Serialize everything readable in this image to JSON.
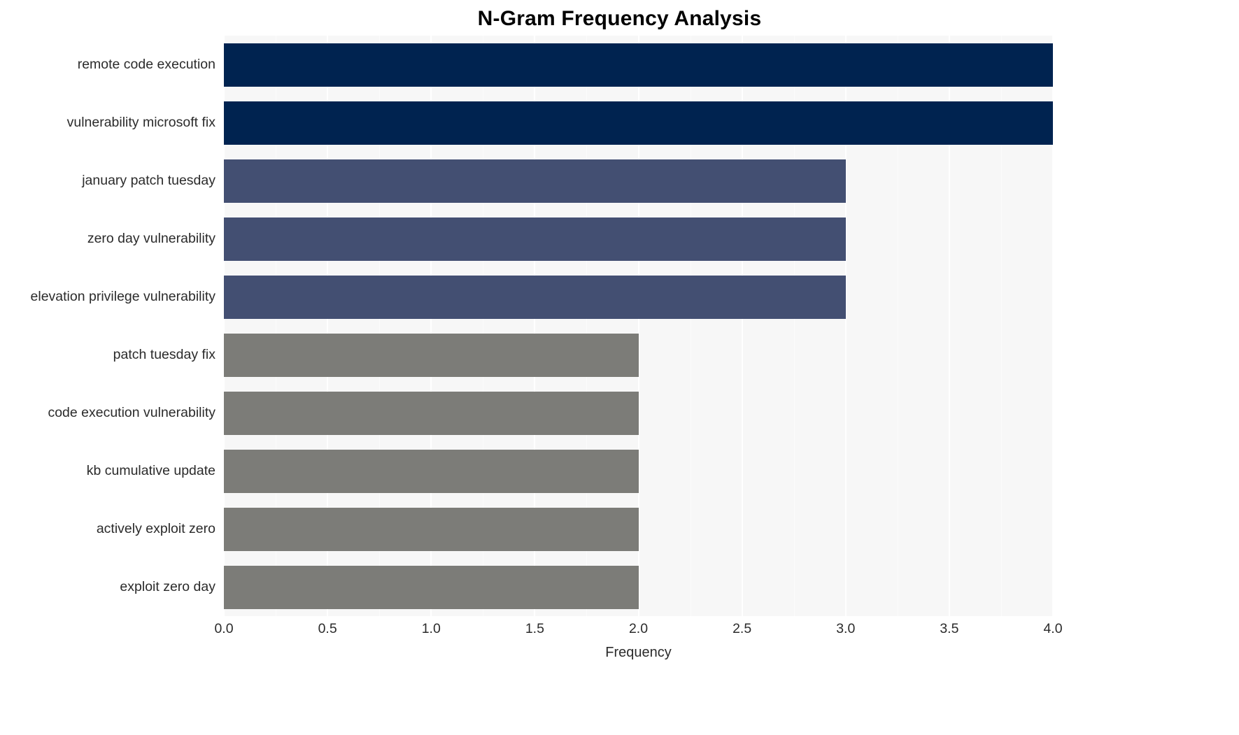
{
  "chart_data": {
    "type": "bar",
    "orientation": "horizontal",
    "title": "N-Gram Frequency Analysis",
    "xlabel": "Frequency",
    "ylabel": "",
    "xlim": [
      0,
      4
    ],
    "xticks": [
      "0.0",
      "0.5",
      "1.0",
      "1.5",
      "2.0",
      "2.5",
      "3.0",
      "3.5",
      "4.0"
    ],
    "xtick_values": [
      0,
      0.5,
      1,
      1.5,
      2,
      2.5,
      3,
      3.5,
      4
    ],
    "grid": true,
    "legend": "none",
    "categories": [
      "remote code execution",
      "vulnerability microsoft fix",
      "january patch tuesday",
      "zero day vulnerability",
      "elevation privilege vulnerability",
      "patch tuesday fix",
      "code execution vulnerability",
      "kb cumulative update",
      "actively exploit zero",
      "exploit zero day"
    ],
    "values": [
      4,
      4,
      3,
      3,
      3,
      2,
      2,
      2,
      2,
      2
    ],
    "bar_colors": [
      "#002350",
      "#002350",
      "#434f72",
      "#434f72",
      "#434f72",
      "#7c7c78",
      "#7c7c78",
      "#7c7c78",
      "#7c7c78",
      "#7c7c78"
    ]
  },
  "style": {
    "plot_background": "#f7f7f7",
    "gridline_color": "#ffffff",
    "page_background": "#ffffff",
    "text_color": "#2b2b2b",
    "title_color": "#000000"
  }
}
